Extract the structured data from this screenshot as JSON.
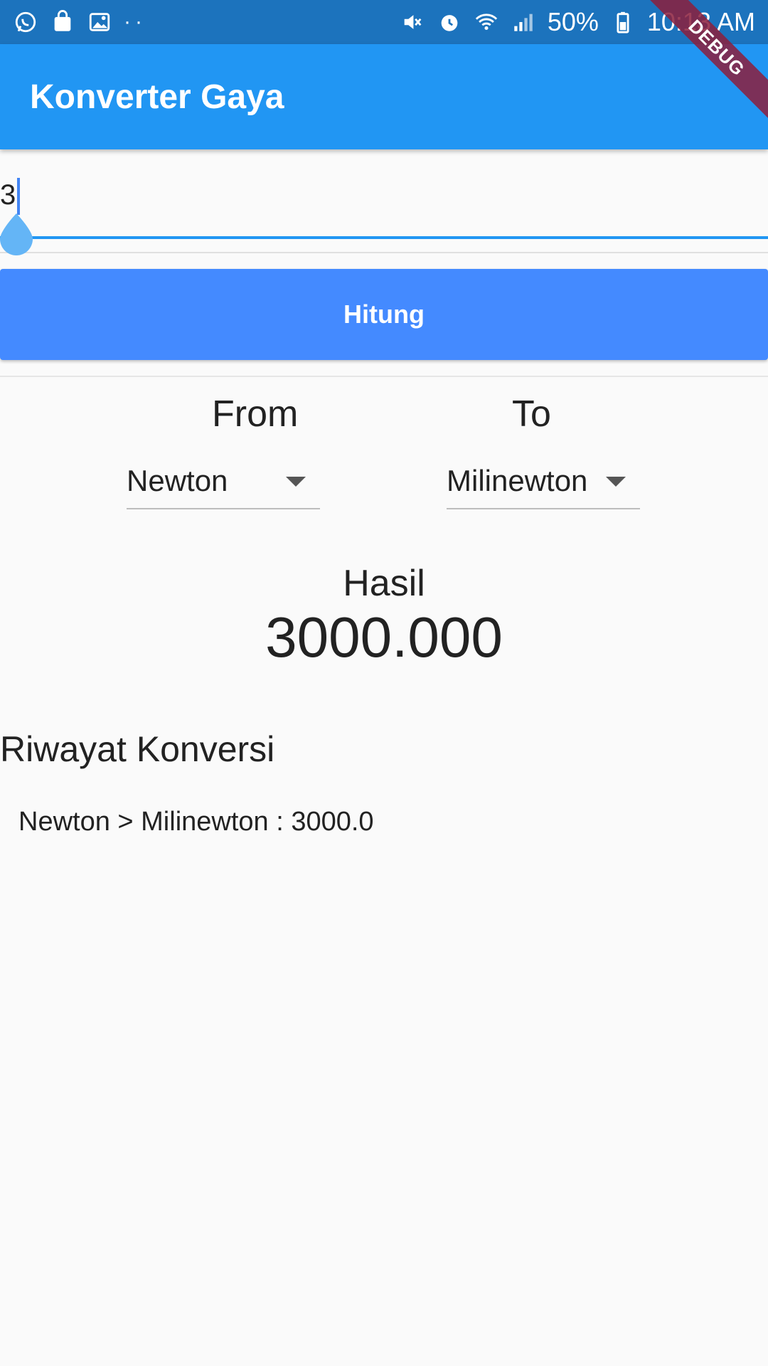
{
  "status_bar": {
    "battery": "50%",
    "time": "10:13 AM",
    "dots": "··",
    "left_icons": [
      "whatsapp-icon",
      "shopping-bag-icon",
      "gallery-icon"
    ],
    "right_icons": [
      "mute-icon",
      "alarm-icon",
      "wifi-icon",
      "signal-icon",
      "battery-icon"
    ]
  },
  "appbar": {
    "title": "Konverter Gaya",
    "color": "#2196f3"
  },
  "debug": {
    "label": "DEBUG"
  },
  "input": {
    "value": "3"
  },
  "button": {
    "label": "Hitung",
    "color": "#448aff"
  },
  "converter": {
    "from_label": "From",
    "to_label": "To",
    "from_value": "Newton",
    "to_value": "Milinewton"
  },
  "result": {
    "label": "Hasil",
    "value": "3000.000"
  },
  "history": {
    "title": "Riwayat Konversi",
    "items": [
      "Newton > Milinewton : 3000.0"
    ]
  }
}
